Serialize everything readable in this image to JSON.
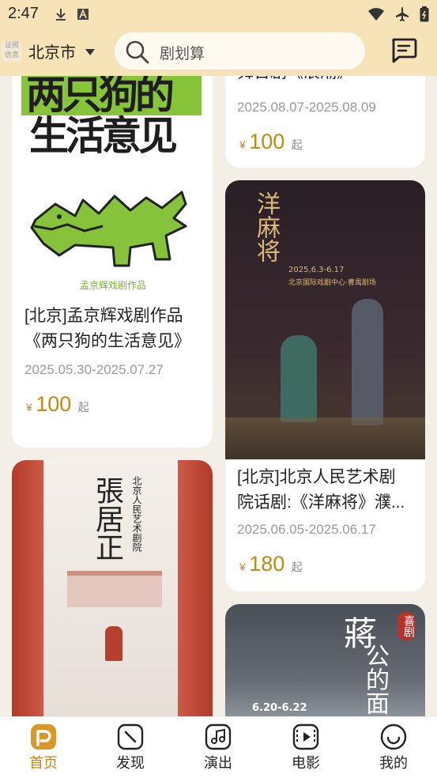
{
  "status_bar": {
    "time": "2:47",
    "icons": [
      "download-icon",
      "a-icon",
      "wifi-icon",
      "airplane-icon",
      "battery-icon"
    ]
  },
  "header": {
    "cert_label": "证照\n信息",
    "city": "北京市",
    "search_placeholder": "剧划算",
    "icons": [
      "chevron-down-icon",
      "search-icon",
      "message-icon"
    ]
  },
  "feed": {
    "left": [
      {
        "poster_title_line1": "两只狗的",
        "poster_title_line2": "生活意见",
        "poster_caption": "孟京辉戏剧作品",
        "title": "[北京]孟京辉戏剧作品《两只狗的生活意见》",
        "title_line1": "[北京]孟京辉戏剧作品",
        "title_line2": "《两只狗的生活意见》",
        "date": "2025.05.30-2025.07.27",
        "currency": "¥",
        "price": "100",
        "suffix": "起"
      },
      {
        "poster_title": "張居正",
        "poster_vertical_text": "北京人民艺术剧院",
        "title": ""
      }
    ],
    "right": [
      {
        "title_fragment": "舞台剧《浪潮》",
        "date": "2025.08.07-2025.08.09",
        "currency": "¥",
        "price": "100",
        "suffix": "起"
      },
      {
        "poster_title": "洋麻将",
        "poster_dates": "2025,6.3-6.17",
        "poster_venue": "北京国际戏剧中心·曹禺剧场",
        "title": "[北京]北京人民艺术剧院话剧:《洋麻将》濮...",
        "title_line1": "[北京]北京人民艺术剧",
        "title_line2": "院话剧:《洋麻将》濮...",
        "date": "2025.06.05-2025.06.17",
        "currency": "¥",
        "price": "180",
        "suffix": "起"
      },
      {
        "poster_title_line1": "蔣",
        "poster_title_line2": "公的面",
        "poster_tag": "喜剧",
        "poster_dates": "6.20-6.22"
      }
    ]
  },
  "tabbar": {
    "tabs": [
      {
        "label": "首页",
        "icon": "home-icon",
        "active": true
      },
      {
        "label": "发现",
        "icon": "compass-icon",
        "active": false
      },
      {
        "label": "演出",
        "icon": "music-icon",
        "active": false
      },
      {
        "label": "电影",
        "icon": "film-icon",
        "active": false
      },
      {
        "label": "我的",
        "icon": "smile-icon",
        "active": false
      }
    ]
  },
  "colors": {
    "header_bg": "#f6e3b8",
    "accent": "#c8860f",
    "price": "#c28a10",
    "page_bg": "#f3eee6"
  }
}
